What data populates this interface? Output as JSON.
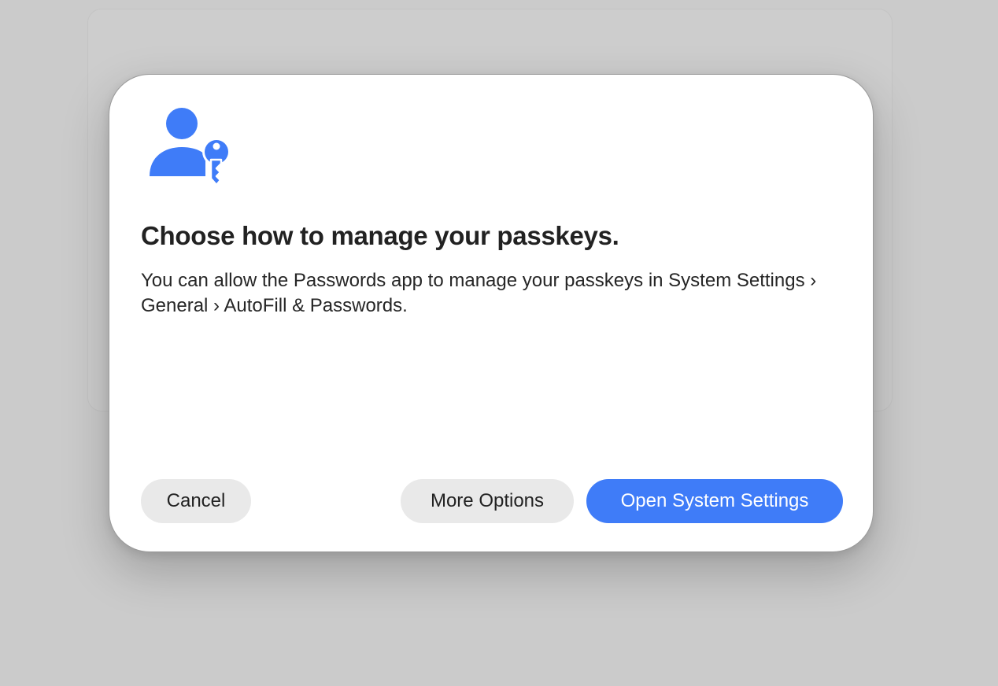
{
  "dialog": {
    "icon": "person-key-icon",
    "accent_color": "#3f7cf8",
    "title": "Choose how to manage your passkeys.",
    "message": "You can allow the Passwords app to manage your passkeys in System Settings › General › AutoFill & Passwords.",
    "buttons": {
      "cancel_label": "Cancel",
      "more_options_label": "More Options",
      "open_settings_label": "Open System Settings"
    }
  }
}
